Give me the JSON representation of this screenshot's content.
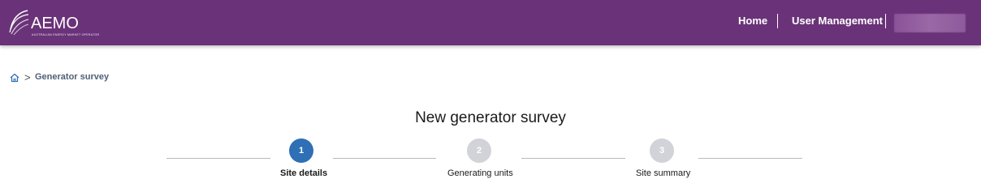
{
  "header": {
    "logo_name": "AEMO",
    "logo_tagline": "AUSTRALIAN ENERGY MARKET OPERATOR",
    "nav": {
      "home": "Home",
      "user_management": "User Management"
    },
    "brand_color": "#6a3278"
  },
  "breadcrumb": {
    "home_icon": "home-icon",
    "separator": ">",
    "current": "Generator survey"
  },
  "page": {
    "title": "New generator survey"
  },
  "stepper": {
    "active_color": "#2e6fb6",
    "inactive_color": "#d1d3d8",
    "steps": [
      {
        "number": "1",
        "label": "Site details",
        "state": "active"
      },
      {
        "number": "2",
        "label": "Generating units",
        "state": "upcoming"
      },
      {
        "number": "3",
        "label": "Site summary",
        "state": "upcoming"
      }
    ]
  }
}
